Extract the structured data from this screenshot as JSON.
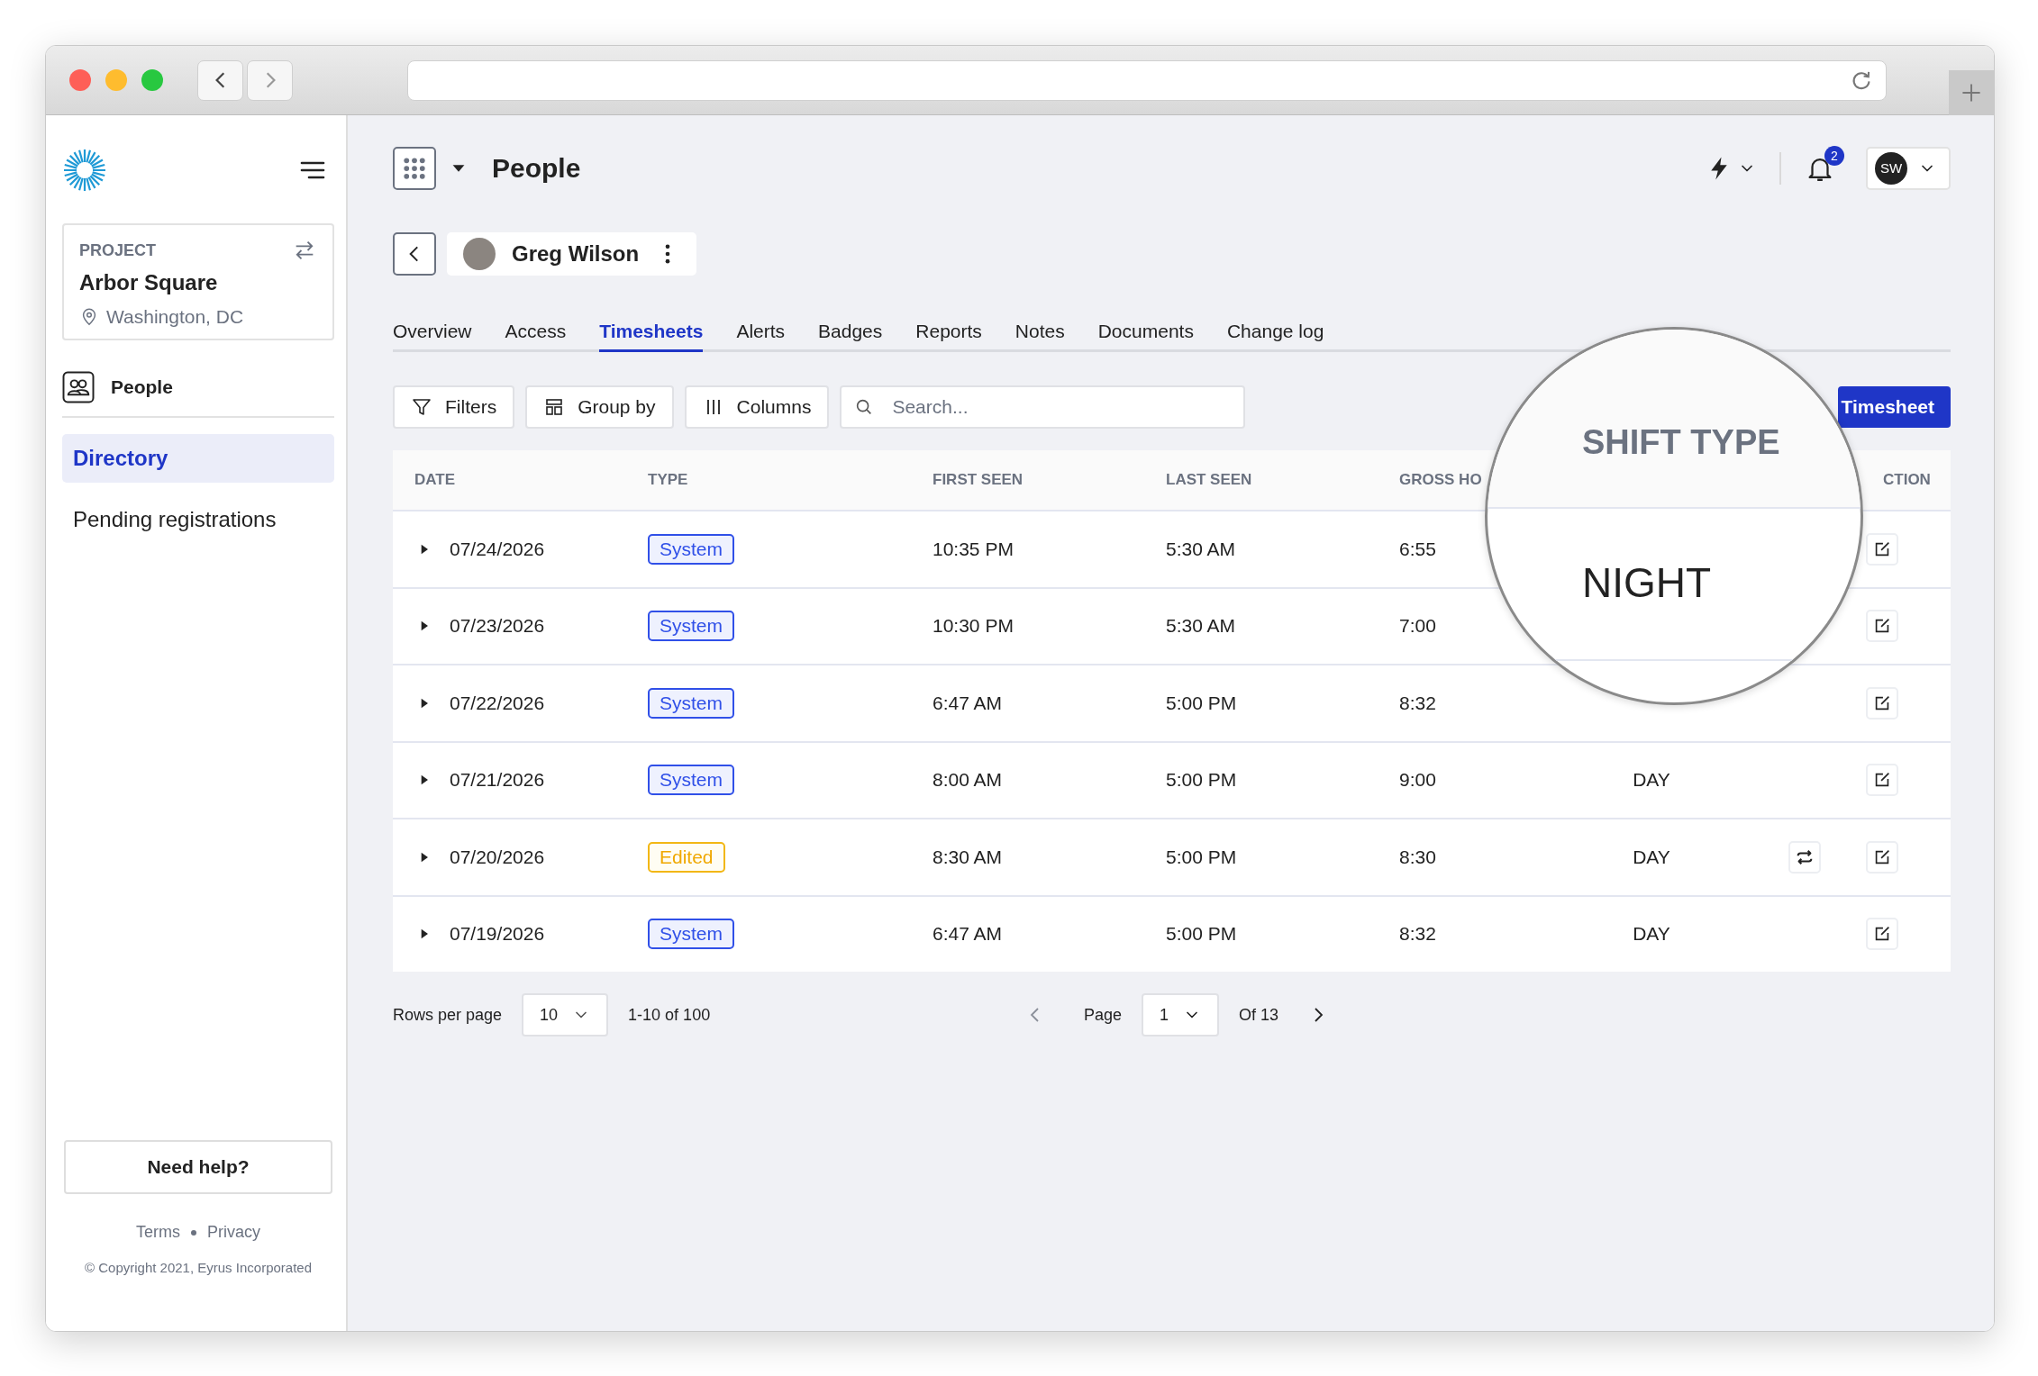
{
  "sidebar": {
    "project": {
      "label": "PROJECT",
      "name": "Arbor Square",
      "location": "Washington, DC"
    },
    "section": "People",
    "items": [
      {
        "label": "Directory",
        "selected": true
      },
      {
        "label": "Pending registrations",
        "selected": false
      }
    ],
    "help_button": "Need help?",
    "links": [
      "Terms",
      "Privacy"
    ],
    "copyright": "© Copyright 2021, Eyrus Incorporated"
  },
  "header": {
    "title": "People",
    "notifications": "2",
    "user_initials": "SW"
  },
  "person": {
    "name": "Greg Wilson"
  },
  "tabs": [
    {
      "label": "Overview",
      "selected": false
    },
    {
      "label": "Access",
      "selected": false
    },
    {
      "label": "Timesheets",
      "selected": true
    },
    {
      "label": "Alerts",
      "selected": false
    },
    {
      "label": "Badges",
      "selected": false
    },
    {
      "label": "Reports",
      "selected": false
    },
    {
      "label": "Notes",
      "selected": false
    },
    {
      "label": "Documents",
      "selected": false
    },
    {
      "label": "Change log",
      "selected": false
    }
  ],
  "toolbar": {
    "buttons": [
      {
        "label": "Filters",
        "kind": "filter"
      },
      {
        "label": "Group by",
        "kind": "group"
      },
      {
        "label": "Columns",
        "kind": "columns"
      }
    ],
    "search": {
      "placeholder": "Search..."
    },
    "primary_button": "Timesheet"
  },
  "table": {
    "columns": [
      "DATE",
      "TYPE",
      "FIRST SEEN",
      "LAST SEEN",
      "GROSS HO",
      "CTION"
    ],
    "rows": [
      {
        "expanded": false,
        "date": "07/24/2026",
        "type": {
          "label": "System",
          "kind": "system"
        },
        "first_seen": "10:35 PM",
        "last_seen": "5:30 AM",
        "gross_hours": "6:55",
        "swap": false
      },
      {
        "expanded": false,
        "date": "07/23/2026",
        "type": {
          "label": "System",
          "kind": "system"
        },
        "first_seen": "10:30 PM",
        "last_seen": "5:30 AM",
        "gross_hours": "7:00",
        "swap": false
      },
      {
        "expanded": false,
        "date": "07/22/2026",
        "type": {
          "label": "System",
          "kind": "system"
        },
        "first_seen": "6:47 AM",
        "last_seen": "5:00 PM",
        "gross_hours": "8:32",
        "swap": false
      },
      {
        "expanded": false,
        "date": "07/21/2026",
        "type": {
          "label": "System",
          "kind": "system"
        },
        "first_seen": "8:00 AM",
        "last_seen": "5:00 PM",
        "gross_hours": "9:00",
        "shift_type": "DAY",
        "swap": false
      },
      {
        "expanded": false,
        "date": "07/20/2026",
        "type": {
          "label": "Edited",
          "kind": "edited"
        },
        "first_seen": "8:30 AM",
        "last_seen": "5:00 PM",
        "gross_hours": "8:30",
        "shift_type": "DAY",
        "swap": true
      },
      {
        "expanded": false,
        "date": "07/19/2026",
        "type": {
          "label": "System",
          "kind": "system"
        },
        "first_seen": "6:47 AM",
        "last_seen": "5:00 PM",
        "gross_hours": "8:32",
        "shift_type": "DAY",
        "swap": false
      }
    ]
  },
  "magnifier": {
    "heading": "SHIFT TYPE",
    "value": "NIGHT"
  },
  "pagination": {
    "rows_label": "Rows per page",
    "rows_value": "10",
    "range": "1-10 of 100",
    "prev_disabled": true,
    "page_label": "Page",
    "page_value": "1",
    "page_total": "Of 13",
    "next_disabled": false
  }
}
